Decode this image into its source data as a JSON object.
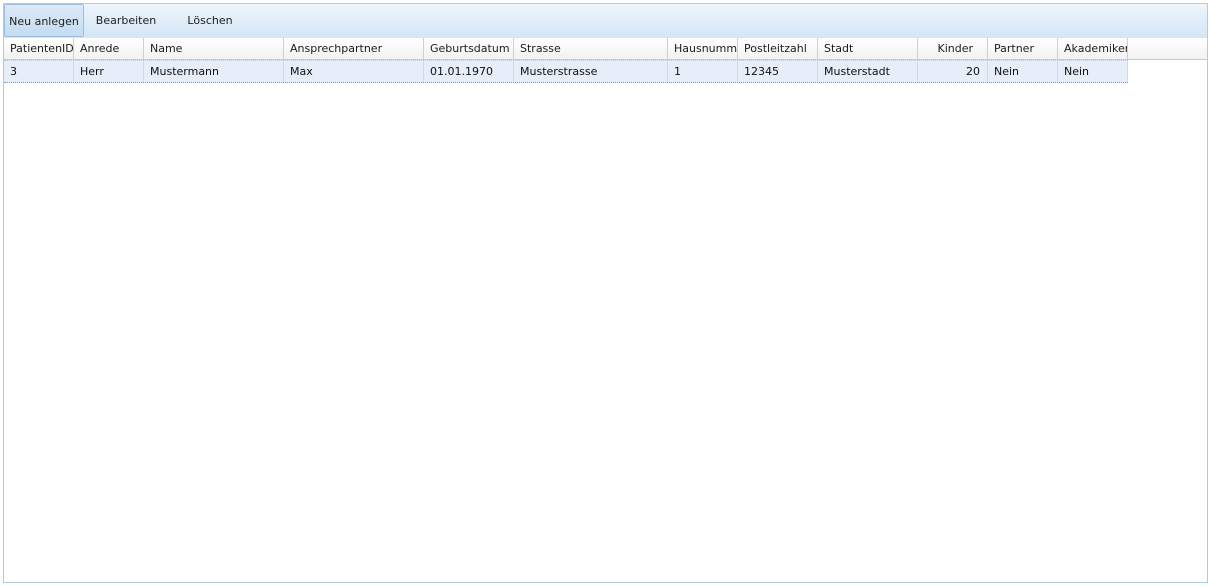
{
  "toolbar": {
    "new_label": "Neu anlegen",
    "edit_label": "Bearbeiten",
    "delete_label": "Löschen"
  },
  "table": {
    "columns": [
      "PatientenID",
      "Anrede",
      "Name",
      "Ansprechpartner",
      "Geburtsdatum",
      "Strasse",
      "Hausnummer",
      "Postleitzahl",
      "Stadt",
      "Kinder",
      "Partner",
      "Akademiker"
    ],
    "rows": [
      [
        "3",
        "Herr",
        "Mustermann",
        "Max",
        "01.01.1970",
        "Musterstrasse",
        "1",
        "12345",
        "Musterstadt",
        "20",
        "Nein",
        "Nein"
      ]
    ]
  },
  "colors": {
    "toolbar_bg": "#dfecf8",
    "selected_row_bg": "#e5eef9",
    "border": "#aecbe6"
  }
}
